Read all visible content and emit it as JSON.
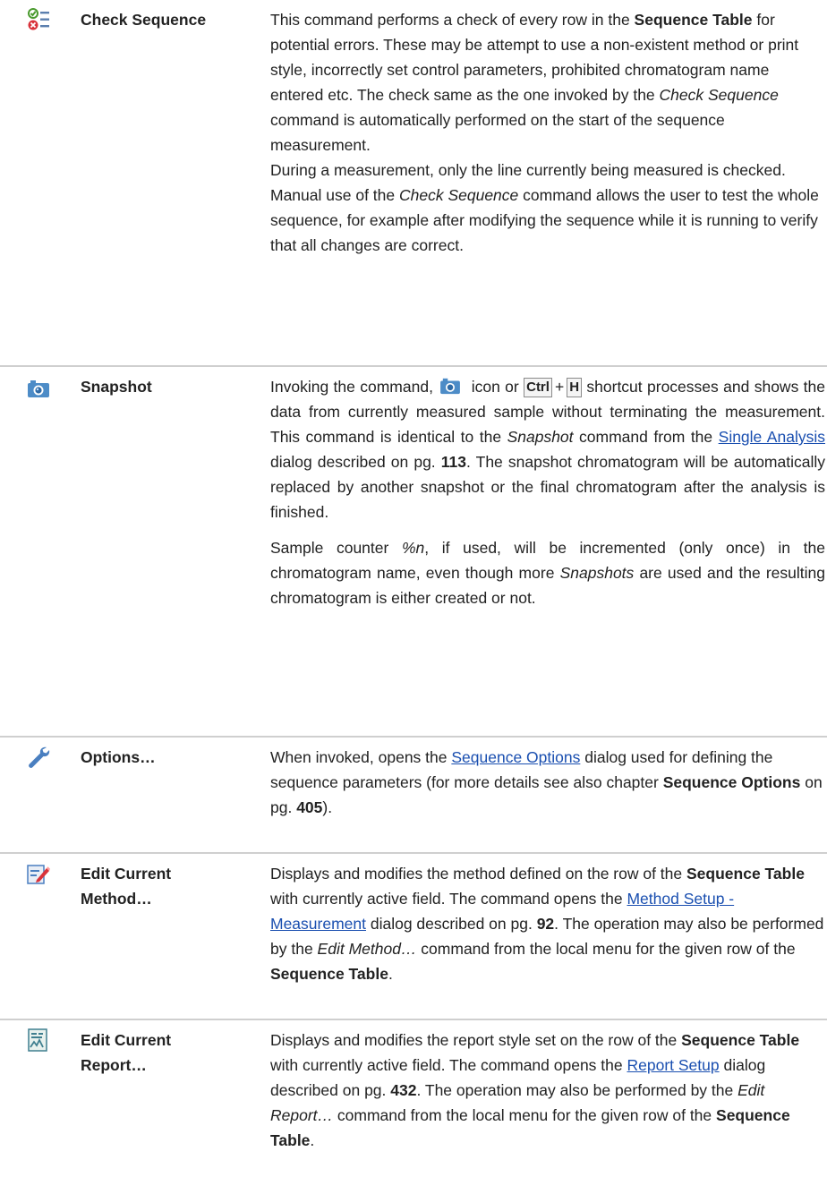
{
  "rows": [
    {
      "icon": "check-sequence-icon",
      "name": "Check Sequence",
      "p1": [
        "This command performs a check of every row in the ",
        "Sequence Table",
        " for potential errors. These may be attempt to use a non-existent method or print style, incorrectly set control parameters, prohibited chromatogram name entered etc. The check same as the one invoked by the ",
        "Check Sequence",
        " command is automatically performed on the start of the sequence measurement."
      ],
      "p2": [
        "During a measurement, only the line currently being measured is checked. Manual use of the ",
        "Check Sequence",
        " command allows the user to test the whole sequence, for example after modifying the sequence while it is running to verify that all changes are correct."
      ]
    },
    {
      "icon": "camera-icon",
      "name": "Snapshot",
      "p1": [
        "Invoking the command, ",
        " icon or ",
        "Ctrl",
        "+",
        "H",
        " shortcut processes and shows the data from currently measured sample without terminating the measurement. This command is identical to the ",
        "Snapshot",
        " command from the ",
        "Single Analysis",
        " dialog described on pg. ",
        "113",
        ". The snapshot chromatogram will be automatically replaced by another snapshot or the final chromatogram after the analysis is finished."
      ],
      "p2": [
        "Sample counter ",
        "%n",
        ", if used, will be incremented (only once) in the chromatogram name, even though more ",
        "Snapshots",
        " are used and the resulting chromatogram is either created or not."
      ]
    },
    {
      "icon": "wrench-icon",
      "name": "Options…",
      "p1": [
        "When invoked, opens the ",
        "Sequence Options",
        " dialog used for defining the sequence parameters (for more details see also chapter ",
        "Sequence Options",
        " on pg. ",
        "405",
        ")."
      ]
    },
    {
      "icon": "edit-method-icon",
      "name_line1": "Edit Current",
      "name_line2": "Method…",
      "p1": [
        "Displays and modifies the method defined on the row of the ",
        "Sequence Table",
        " with currently active field. The command opens the ",
        "Method Setup - Measurement",
        " dialog described on pg. ",
        "92",
        ". The operation may also be performed by the ",
        "Edit Method…",
        " command from the local menu for the given row of the ",
        "Sequence Table",
        "."
      ]
    },
    {
      "icon": "edit-report-icon",
      "name_line1": "Edit Current",
      "name_line2": "Report…",
      "p1": [
        "Displays and modifies the report style set on the row of the ",
        "Sequence Table",
        " with currently active field. The command opens the ",
        "Report Setup",
        " dialog described on pg. ",
        "432",
        ". The operation may also be performed by the ",
        "Edit Report…",
        " command from the local menu for the given row of the ",
        "Sequence Table",
        "."
      ]
    }
  ],
  "colors": {
    "link": "#1a4fb0",
    "separator": "#cfcfcf",
    "text": "#222222"
  }
}
